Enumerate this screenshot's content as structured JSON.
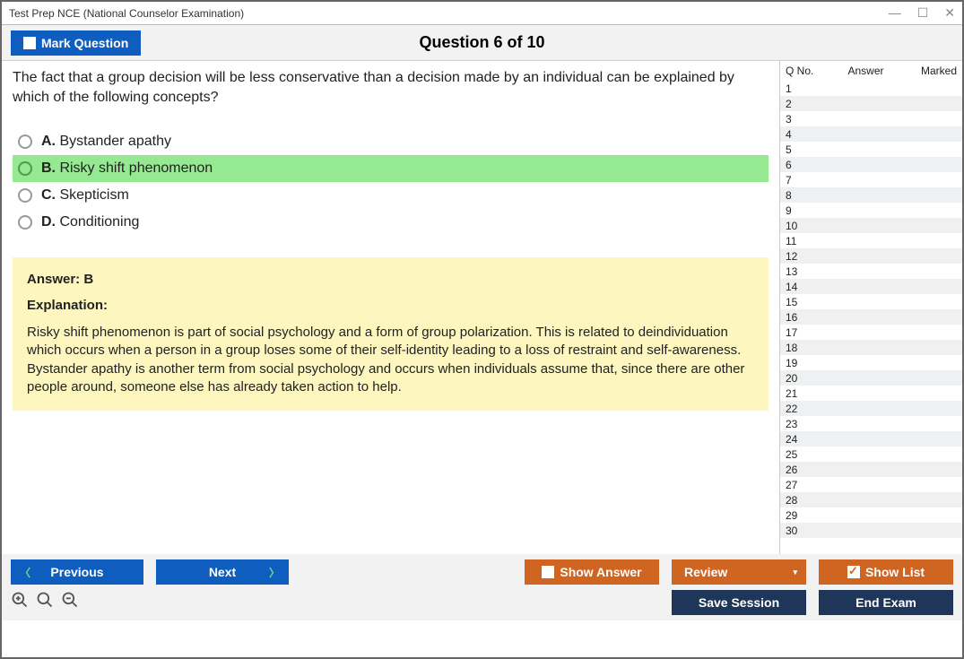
{
  "window": {
    "title": "Test Prep NCE (National Counselor Examination)"
  },
  "topbar": {
    "mark_label": "Mark Question",
    "counter": "Question 6 of 10"
  },
  "question": {
    "stem": "The fact that a group decision will be less conservative than a decision made by an individual can be explained by which of the following concepts?",
    "options": [
      {
        "letter": "A.",
        "text": "Bystander apathy",
        "highlight": false
      },
      {
        "letter": "B.",
        "text": "Risky shift phenomenon",
        "highlight": true
      },
      {
        "letter": "C.",
        "text": "Skepticism",
        "highlight": false
      },
      {
        "letter": "D.",
        "text": "Conditioning",
        "highlight": false
      }
    ]
  },
  "explanation": {
    "answer_line": "Answer: B",
    "heading": "Explanation:",
    "body": "Risky shift phenomenon is part of social psychology and a form of group polarization. This is related to deindividuation which occurs when a person in a group loses some of their self-identity leading to a loss of restraint and self-awareness. Bystander apathy is another term from social psychology and occurs when individuals assume that, since there are other people around, someone else has already taken action to help."
  },
  "side": {
    "headers": {
      "qno": "Q No.",
      "answer": "Answer",
      "marked": "Marked"
    },
    "row_count": 30
  },
  "footer": {
    "previous": "Previous",
    "next": "Next",
    "show_answer": "Show Answer",
    "review": "Review",
    "show_list": "Show List",
    "save_session": "Save Session",
    "end_exam": "End Exam"
  }
}
